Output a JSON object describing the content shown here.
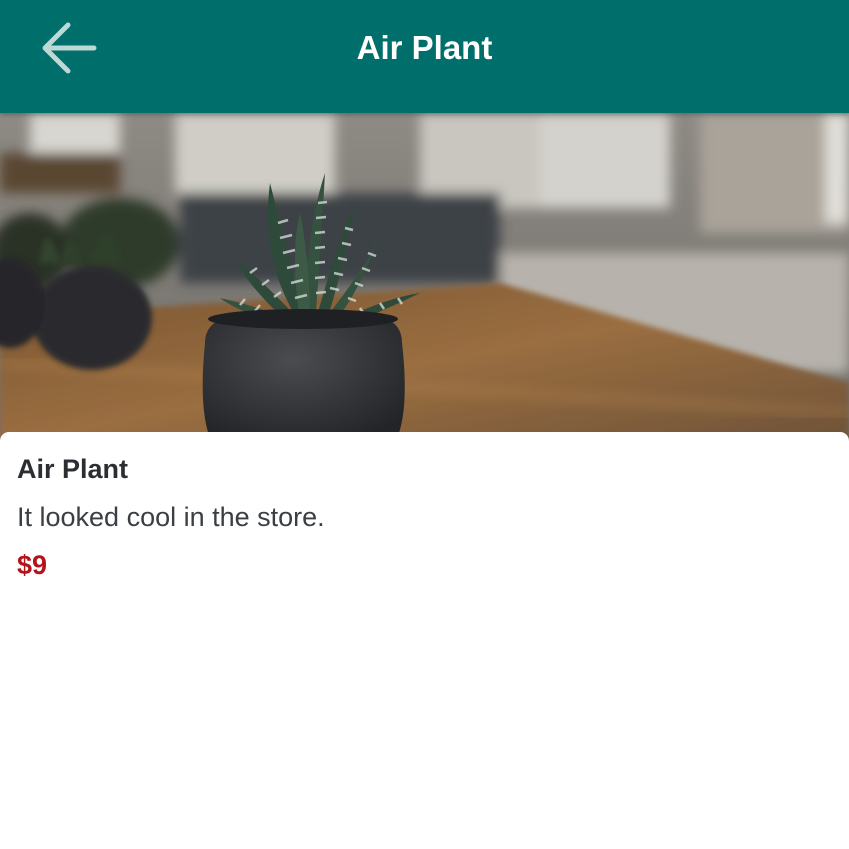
{
  "app_bar": {
    "title": "Air Plant",
    "back_icon": "arrow-left-icon",
    "background_color": "#006e6a"
  },
  "hero_image": {
    "subject": "potted succulent plant on table"
  },
  "product": {
    "name": "Air Plant",
    "description": "It looked cool in the store.",
    "price": "$9",
    "price_color": "#b3141b"
  }
}
